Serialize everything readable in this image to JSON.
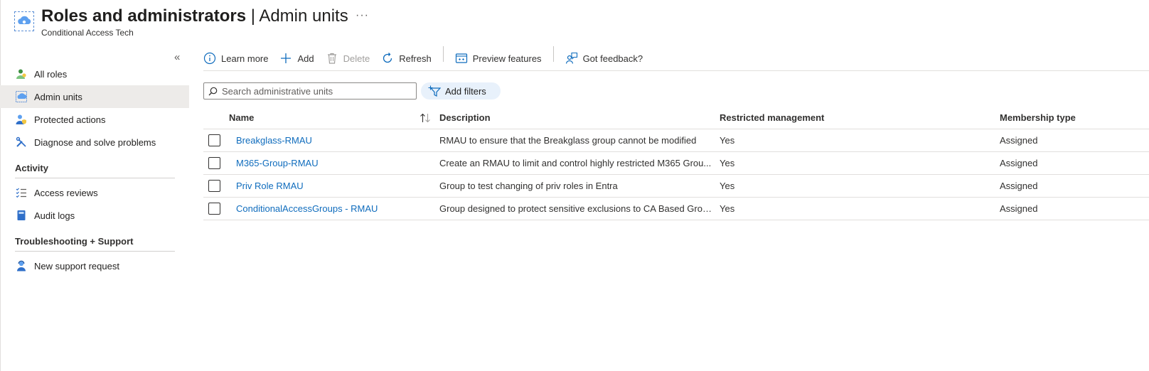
{
  "header": {
    "title_main": "Roles and administrators",
    "title_sep": " | ",
    "title_sub": "Admin units",
    "more": "···",
    "subtitle": "Conditional Access Tech"
  },
  "sidebar": {
    "collapse": "«",
    "items": [
      {
        "label": "All roles",
        "icon": "roles-icon"
      },
      {
        "label": "Admin units",
        "icon": "admin-units-icon",
        "active": true
      },
      {
        "label": "Protected actions",
        "icon": "protected-actions-icon"
      },
      {
        "label": "Diagnose and solve problems",
        "icon": "wrench-icon"
      }
    ],
    "sections": [
      {
        "title": "Activity",
        "items": [
          {
            "label": "Access reviews",
            "icon": "checklist-icon"
          },
          {
            "label": "Audit logs",
            "icon": "book-icon"
          }
        ]
      },
      {
        "title": "Troubleshooting + Support",
        "items": [
          {
            "label": "New support request",
            "icon": "support-person-icon"
          }
        ]
      }
    ]
  },
  "toolbar": {
    "learn_more": "Learn more",
    "add": "Add",
    "delete": "Delete",
    "refresh": "Refresh",
    "preview_features": "Preview features",
    "feedback": "Got feedback?"
  },
  "search": {
    "placeholder": "Search administrative units"
  },
  "filter": {
    "label": "Add filters"
  },
  "table": {
    "columns": {
      "name": "Name",
      "description": "Description",
      "restricted": "Restricted management",
      "membership": "Membership type"
    },
    "rows": [
      {
        "name": "Breakglass-RMAU",
        "description": "RMAU to ensure that the Breakglass group cannot be modified",
        "restricted": "Yes",
        "membership": "Assigned"
      },
      {
        "name": "M365-Group-RMAU",
        "description": "Create an RMAU to limit and control highly restricted M365 Grou...",
        "restricted": "Yes",
        "membership": "Assigned"
      },
      {
        "name": "Priv Role RMAU",
        "description": "Group to test changing of priv roles in Entra",
        "restricted": "Yes",
        "membership": "Assigned"
      },
      {
        "name": "ConditionalAccessGroups - RMAU",
        "description": "Group designed to protect sensitive exclusions to CA Based Grou...",
        "restricted": "Yes",
        "membership": "Assigned"
      }
    ]
  },
  "colors": {
    "accent": "#0f6cbd",
    "active_bg": "#edebe9",
    "filter_bg": "#e8f1fb"
  }
}
